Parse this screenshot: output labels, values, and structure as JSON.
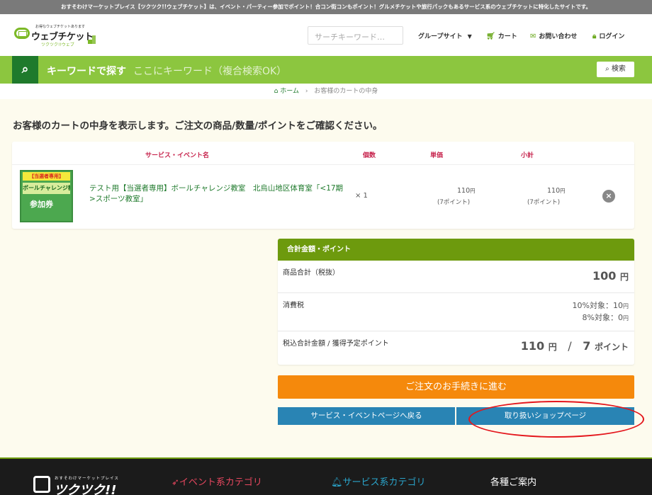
{
  "topbar": {
    "text": "おすそわけマーケットプレイス【ツクツク!!ウェブチケット】は、イベント・パーティー参加でポイント！合コン街コンもポイント！グルメチケットや旅行パックもあるサービス系のウェブチケットに特化したサイトです。"
  },
  "header": {
    "logo_tagline": "お得なウェブチケットあります",
    "logo_text": "ウェブチケット",
    "logo_sub": "ツクツク!!ウェブ",
    "search_placeholder": "サーチキーワード…",
    "nav": {
      "group": "グループサイト",
      "cart": "カート",
      "contact": "お問い合わせ",
      "login": "ログイン"
    }
  },
  "search_bar": {
    "label": "キーワードで探す",
    "placeholder": "ここにキーワード（複合検索OK）",
    "button": "検索"
  },
  "breadcrumb": {
    "home": "ホーム",
    "separator": "›",
    "current": "お客様のカートの中身"
  },
  "page": {
    "heading": "お客様のカートの中身を表示します。ご注文の商品/数量/ポイントをご確認ください。"
  },
  "cart": {
    "columns": {
      "name": "サービス・イベント名",
      "qty": "個数",
      "unit_price": "単価",
      "subtotal": "小計"
    },
    "items": [
      {
        "thumb_top": "【当選者専用】",
        "thumb_mid": "ボールチャレンジ教室",
        "thumb_bottom": "参加券",
        "name": "テスト用【当選者専用】ボールチャレンジ教室　北烏山地区体育室「<17期>スポーツ教室」",
        "qty": "× 1",
        "unit_price": "110",
        "unit_points": "(7ポイント)",
        "subtotal": "110",
        "subtotal_points": "(7ポイント)",
        "yen": "円",
        "remove": "×"
      }
    ]
  },
  "summary": {
    "title": "合計金額・ポイント",
    "subtotal_label": "商品合計（税抜）",
    "subtotal_value": "100",
    "yen": "円",
    "tax_label": "消費税",
    "tax_10": "10%対象：10",
    "tax_8": "8%対象：0",
    "total_label": "税込合計金額 / 獲得予定ポイント",
    "total_value": "110",
    "slash": "/",
    "points_value": "7",
    "points_unit": "ポイント"
  },
  "buttons": {
    "order": "ご注文のお手続きに進む",
    "back": "サービス・イベントページへ戻る",
    "shop": "取り扱いショップページ"
  },
  "footer": {
    "logo_tag": "おすそわけマーケットプレイス",
    "logo_text": "ツクツク!!",
    "event_heading": "イベント系カテゴリ",
    "service_heading": "サービス系カテゴリ",
    "info_heading": "各種ご案内"
  },
  "colors": {
    "accent": "#8cc63f",
    "dark_green": "#1f7a2c",
    "order": "#f5890c",
    "blue": "#2984b4",
    "highlight": "#e4161c"
  }
}
